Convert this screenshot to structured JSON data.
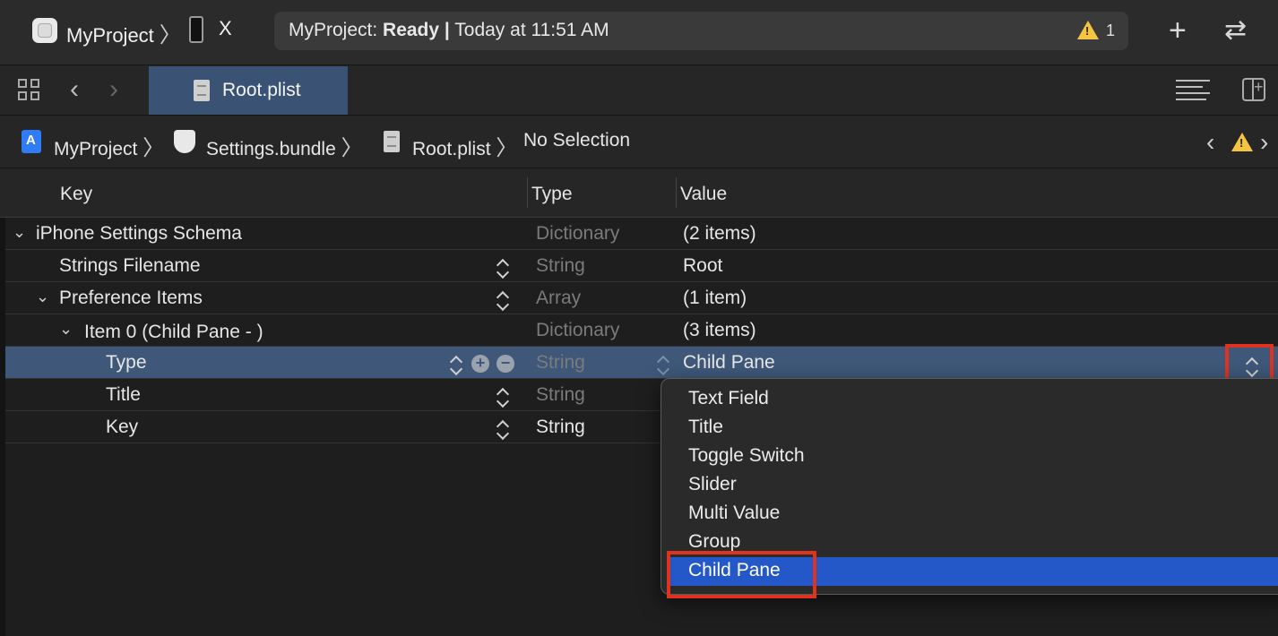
{
  "toolbar": {
    "project_name": "MyProject",
    "device_name": "X",
    "status_project": "MyProject:",
    "status_state": "Ready",
    "status_sep": "|",
    "status_time": "Today at 11:51 AM",
    "warning_count": "1"
  },
  "tab": {
    "label": "Root.plist"
  },
  "breadcrumb": {
    "items": [
      "MyProject",
      "Settings.bundle",
      "Root.plist",
      "No Selection"
    ]
  },
  "table": {
    "headers": {
      "key": "Key",
      "type": "Type",
      "value": "Value"
    },
    "rows": [
      {
        "key": "iPhone Settings Schema",
        "type": "Dictionary",
        "value": "(2 items)"
      },
      {
        "key": "Strings Filename",
        "type": "String",
        "value": "Root"
      },
      {
        "key": "Preference Items",
        "type": "Array",
        "value": "(1 item)"
      },
      {
        "key": "Item 0 (Child Pane - )",
        "type": "Dictionary",
        "value": "(3 items)"
      },
      {
        "key": "Type",
        "type": "String",
        "value": "Child Pane"
      },
      {
        "key": "Title",
        "type": "String",
        "value": ""
      },
      {
        "key": "Key",
        "type": "String",
        "value": ""
      }
    ]
  },
  "popup": {
    "options": [
      "Text Field",
      "Title",
      "Toggle Switch",
      "Slider",
      "Multi Value",
      "Group",
      "Child Pane"
    ],
    "selected": "Child Pane"
  },
  "colors": {
    "selection_row": "#3f5879",
    "menu_highlight": "#2458c8",
    "annotation_box": "#e0331f",
    "warning": "#f5c542"
  }
}
